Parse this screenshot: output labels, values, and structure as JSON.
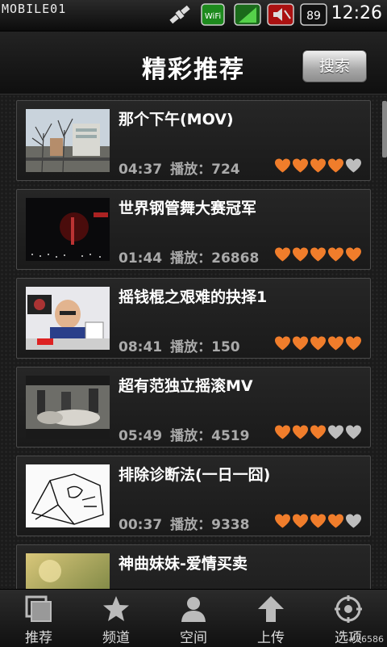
{
  "status_bar": {
    "watermark": "MOBILE01",
    "icons": [
      "satellite-icon",
      "wifi-icon",
      "signal-icon",
      "sound-off-icon",
      "battery-icon"
    ],
    "wifi_label": "WiFi",
    "battery": "89",
    "time": "12:26"
  },
  "header": {
    "title": "精彩推荐",
    "search_label": "搜索"
  },
  "colors": {
    "heart_on": "#f07d2b",
    "heart_off": "#bdbdbd",
    "background": "#1b1b1b"
  },
  "videos": [
    {
      "title": "那个下午(MOV)",
      "duration": "04:37",
      "plays_label": "播放：",
      "plays": "724",
      "rating": 4
    },
    {
      "title": "世界钢管舞大赛冠军",
      "duration": "01:44",
      "plays_label": "播放：",
      "plays": "26868",
      "rating": 5
    },
    {
      "title": "摇钱棍之艰难的抉择1",
      "duration": "08:41",
      "plays_label": "播放：",
      "plays": "150",
      "rating": 5
    },
    {
      "title": "超有范独立摇滚MV",
      "duration": "05:49",
      "plays_label": "播放：",
      "plays": "4519",
      "rating": 3
    },
    {
      "title": "排除诊断法(一日一囧)",
      "duration": "00:37",
      "plays_label": "播放：",
      "plays": "9338",
      "rating": 4
    },
    {
      "title": "神曲妹妹-爱情买卖",
      "duration": "",
      "plays_label": "",
      "plays": "",
      "rating": 0
    }
  ],
  "tabs": [
    {
      "label": "推荐",
      "icon": "recommend-icon"
    },
    {
      "label": "频道",
      "icon": "star-icon"
    },
    {
      "label": "空间",
      "icon": "user-icon"
    },
    {
      "label": "上传",
      "icon": "upload-arrow-icon"
    },
    {
      "label": "选项",
      "icon": "options-icon"
    }
  ],
  "image_id": "#76586"
}
